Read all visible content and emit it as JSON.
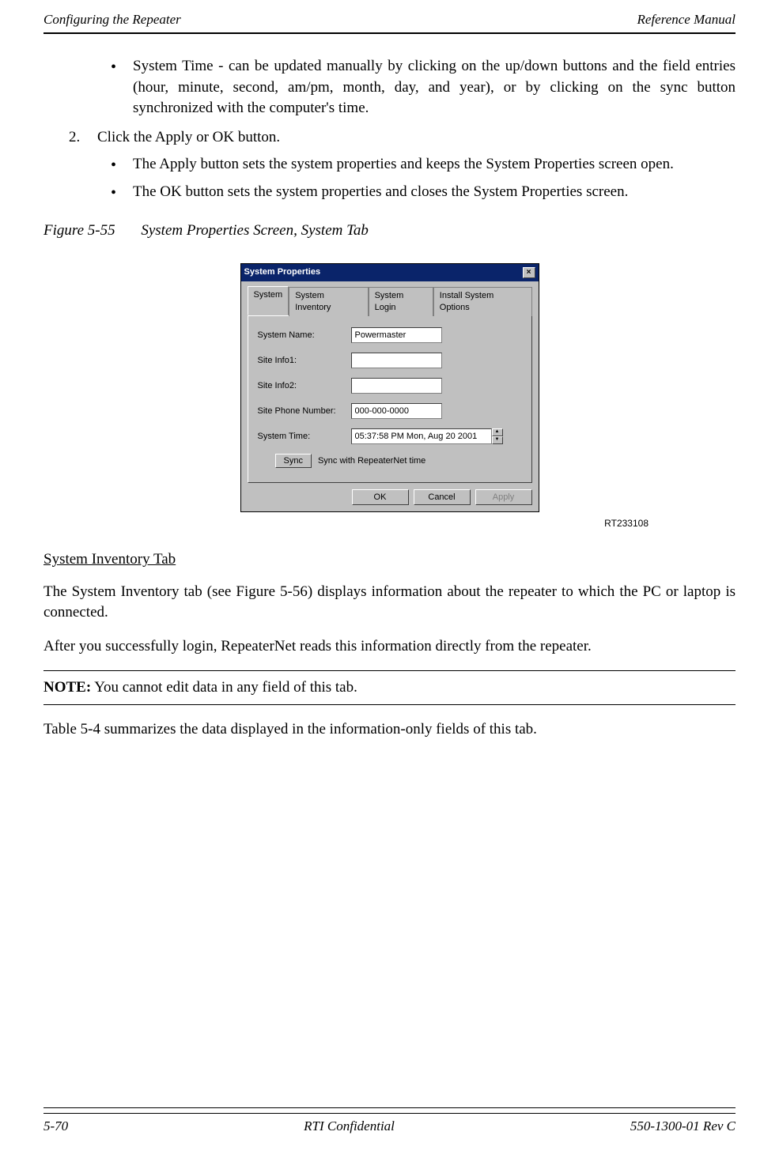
{
  "header": {
    "left": "Configuring the Repeater",
    "right": "Reference Manual"
  },
  "bullets1": {
    "b1": "System Time - can be updated manually by clicking on the up/down buttons and the field entries (hour, minute, second, am/pm, month, day, and year), or by clicking on the sync button synchronized with the computer's time."
  },
  "step2": {
    "num": "2.",
    "text": "Click the Apply or OK button."
  },
  "bullets2": {
    "b1": "The Apply button sets the system properties and keeps the System Properties screen open.",
    "b2": "The OK button sets the system properties and closes the System Properties screen."
  },
  "figcap": {
    "num": "Figure 5-55",
    "title": "System Properties Screen, System Tab"
  },
  "dialog": {
    "title": "System Properties",
    "tabs": {
      "t1": "System",
      "t2": "System Inventory",
      "t3": "System Login",
      "t4": "Install System Options"
    },
    "labels": {
      "l1": "System Name:",
      "l2": "Site Info1:",
      "l3": "Site Info2:",
      "l4": "Site Phone Number:",
      "l5": "System Time:"
    },
    "values": {
      "name": "Powermaster",
      "info1": "",
      "info2": "",
      "phone": "000-000-0000",
      "time": "05:37:58 PM Mon, Aug 20 2001"
    },
    "sync_btn": "Sync",
    "sync_label": "Sync with RepeaterNet time",
    "ok": "OK",
    "cancel": "Cancel",
    "apply": "Apply"
  },
  "img_id": "RT233108",
  "section": {
    "heading": "System Inventory Tab",
    "p1": "The System Inventory tab (see Figure 5-56) displays information about the repeater to which the PC or laptop is connected.",
    "p2": "After you successfully login, RepeaterNet reads this information directly from the repeater.",
    "note_label": "NOTE:",
    "note_text": "  You cannot edit data in any field of this tab.",
    "p3": "Table 5-4 summarizes the data displayed in the information-only fields of this tab."
  },
  "footer": {
    "left": "5-70",
    "center": "RTI Confidential",
    "right": "550-1300-01 Rev C"
  }
}
